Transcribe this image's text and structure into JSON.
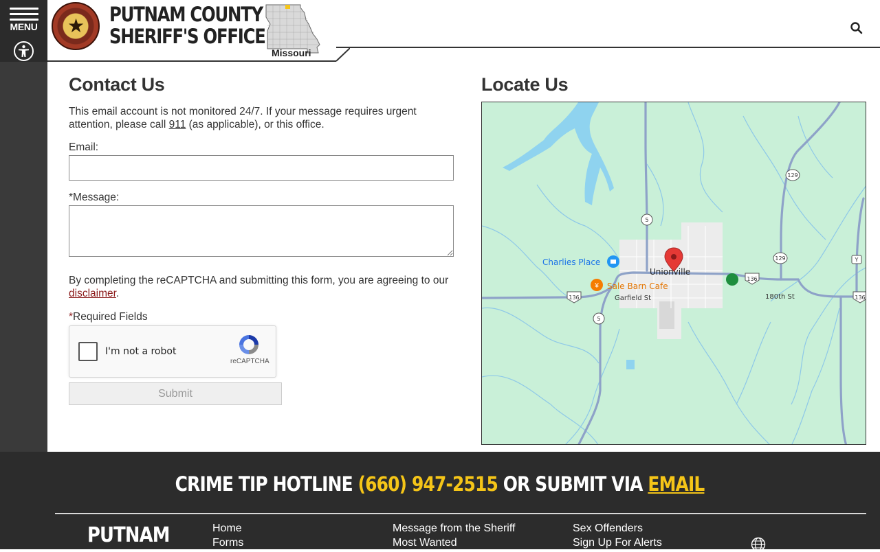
{
  "sidebar": {
    "menu_label": "MENU"
  },
  "header": {
    "line1": "PUTNAM COUNTY",
    "line2": "SHERIFF'S OFFICE",
    "map_label": "Missouri"
  },
  "contact": {
    "title": "Contact Us",
    "notice_before": "This email account is not monitored 24/7. If your message requires urgent attention, please call ",
    "notice_link": "911",
    "notice_after": " (as applicable), or this office.",
    "email_label": "Email:",
    "email_value": "",
    "message_label": "*Message:",
    "message_value": "",
    "agree_before": "By completing the reCAPTCHA and submitting this form, you are agreeing to our ",
    "agree_link": "disclaimer",
    "agree_after": ".",
    "required_star": "*",
    "required_label": "Required Fields",
    "captcha_text": "I'm not a robot",
    "captcha_brand": "reCAPTCHA",
    "submit_label": "Submit"
  },
  "locate": {
    "title": "Locate Us",
    "map": {
      "town": "Unionville",
      "poi_1": "Charlies Place",
      "poi_2": "Sale Barn Cafe",
      "street_1": "Garfield St",
      "street_2": "180th St",
      "route_5": "5",
      "route_129": "129",
      "route_136": "136",
      "route_y": "Y"
    }
  },
  "footer": {
    "hotline_before": "CRIME TIP HOTLINE ",
    "hotline_phone": "(660) 947-2515",
    "hotline_mid": " OR SUBMIT VIA ",
    "hotline_email": "EMAIL",
    "brand": "PUTNAM",
    "col1": [
      "Home",
      "Forms"
    ],
    "col2": [
      "Message from the Sheriff",
      "Most Wanted"
    ],
    "col3": [
      "Sex Offenders",
      "Sign Up For Alerts"
    ]
  },
  "colors": {
    "accent_yellow": "#f5c518",
    "link_red": "#8b1a1a",
    "footer_bg": "#2c2c2c",
    "map_green": "#c9f0d8",
    "map_water": "#8fd3ef",
    "pin_red": "#e53935"
  }
}
